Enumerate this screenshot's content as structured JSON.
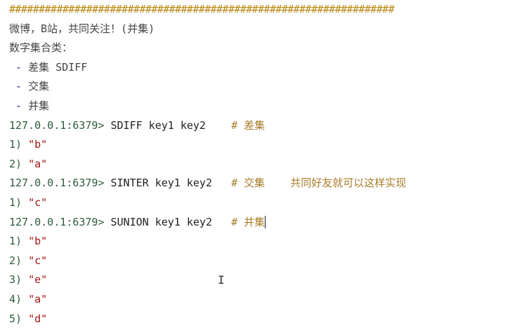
{
  "header_rule": "#################################################################",
  "lines": {
    "intro": "微博，B站，共同关注！(并集)",
    "category": "数字集合类：",
    "bullets": [
      "差集 SDIFF",
      "交集",
      "并集"
    ]
  },
  "commands": [
    {
      "prompt": "127.0.0.1:6379>",
      "cmd": " SDIFF key1 key2    ",
      "comment": "# 差集",
      "results": [
        {
          "n": "1)",
          "v": "\"b\""
        },
        {
          "n": "2)",
          "v": "\"a\""
        }
      ]
    },
    {
      "prompt": "127.0.0.1:6379>",
      "cmd": " SINTER key1 key2   ",
      "comment": "# 交集    共同好友就可以这样实现",
      "results": [
        {
          "n": "1)",
          "v": "\"c\""
        }
      ]
    },
    {
      "prompt": "127.0.0.1:6379>",
      "cmd": " SUNION key1 key2   ",
      "comment": "# 并集",
      "results": [
        {
          "n": "1)",
          "v": "\"b\""
        },
        {
          "n": "2)",
          "v": "\"c\""
        },
        {
          "n": "3)",
          "v": "\"e\""
        },
        {
          "n": "4)",
          "v": "\"a\""
        },
        {
          "n": "5)",
          "v": "\"d\""
        }
      ]
    }
  ],
  "bullet_marker": "-"
}
